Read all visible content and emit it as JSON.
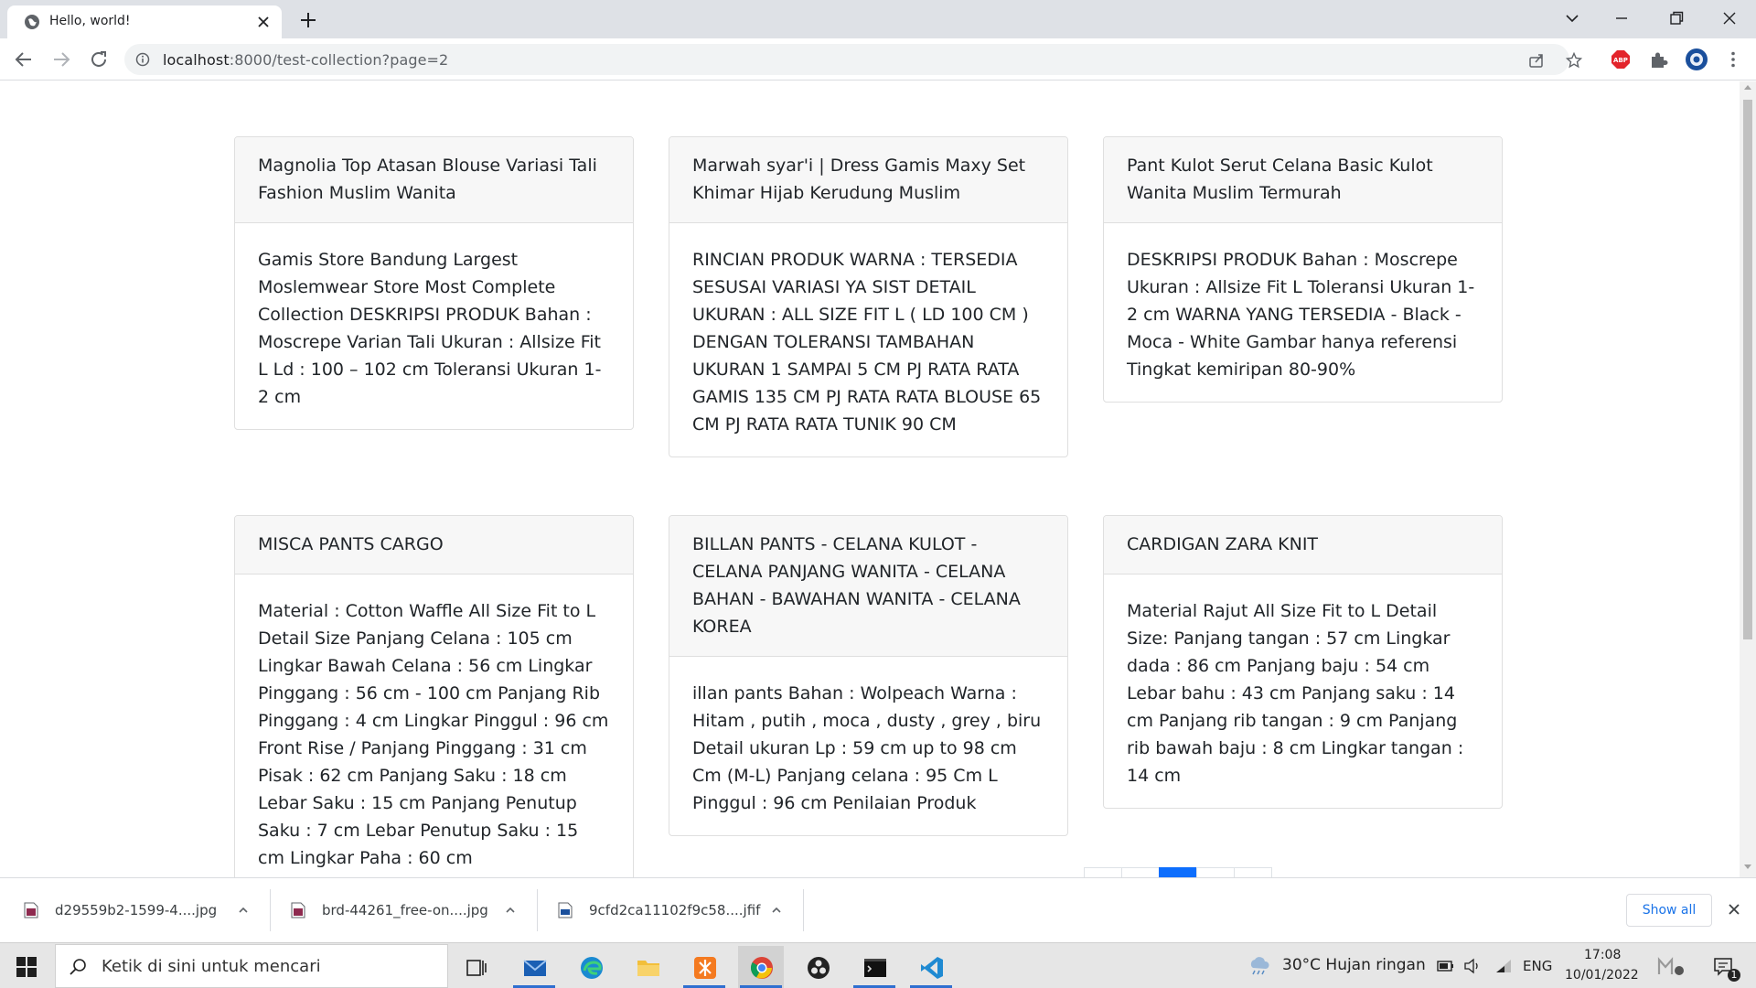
{
  "browser": {
    "tab": {
      "title": "Hello, world!"
    },
    "url": {
      "host": "localhost",
      "rest": ":8000/test-collection?page=2"
    }
  },
  "page": {
    "cards": [
      {
        "title": "Magnolia Top Atasan Blouse Variasi Tali Fashion Muslim Wanita",
        "body": "Gamis Store Bandung Largest Moslemwear Store Most Complete Collection DESKRIPSI PRODUK Bahan : Moscrepe Varian Tali Ukuran : Allsize Fit L Ld : 100 – 102 cm Toleransi Ukuran 1-2 cm"
      },
      {
        "title": "Marwah syar'i | Dress Gamis Maxy Set Khimar Hijab Kerudung Muslim",
        "body": "RINCIAN PRODUK WARNA : TERSEDIA SESUSAI VARIASI YA SIST DETAIL UKURAN : ALL SIZE FIT L ( LD 100 CM ) DENGAN TOLERANSI TAMBAHAN UKURAN 1 SAMPAI 5 CM PJ RATA RATA GAMIS 135 CM PJ RATA RATA BLOUSE 65 CM PJ RATA RATA TUNIK 90 CM"
      },
      {
        "title": "Pant Kulot Serut Celana Basic Kulot Wanita Muslim Termurah",
        "body": "DESKRIPSI PRODUK Bahan : Moscrepe Ukuran : Allsize Fit L Toleransi Ukuran 1-2 cm WARNA YANG TERSEDIA - Black - Moca - White Gambar hanya referensi Tingkat kemiripan 80-90%"
      },
      {
        "title": "MISCA PANTS CARGO",
        "body": "Material : Cotton Waffle All Size Fit to L Detail Size Panjang Celana : 105 cm Lingkar Bawah Celana : 56 cm Lingkar Pinggang : 56 cm - 100 cm Panjang Rib Pinggang : 4 cm Lingkar Pinggul : 96 cm Front Rise / Panjang Pinggang : 31 cm Pisak : 62 cm Panjang Saku : 18 cm Lebar Saku : 15 cm Panjang Penutup Saku : 7 cm Lebar Penutup Saku : 15 cm Lingkar Paha : 60 cm"
      },
      {
        "title": "BILLAN PANTS - CELANA KULOT - CELANA PANJANG WANITA - CELANA BAHAN - BAWAHAN WANITA - CELANA KOREA",
        "body": "illan pants Bahan : Wolpeach Warna : Hitam , putih , moca , dusty , grey , biru Detail ukuran Lp : 59 cm up to 98 cm Cm (M-L) Panjang celana : 95 Cm L Pinggul : 96 cm Penilaian Produk"
      },
      {
        "title": "CARDIGAN ZARA KNIT",
        "body": "Material Rajut All Size Fit to L Detail Size: Panjang tangan : 57 cm Lingkar dada : 86 cm Panjang baju : 54 cm Lebar bahu : 43 cm Panjang saku : 14 cm Panjang rib tangan : 9 cm Panjang rib bawah baju : 8 cm Lingkar tangan : 14 cm"
      }
    ],
    "pagination": {
      "active_page": 2,
      "accent": "#0d6efd"
    }
  },
  "downloads": {
    "items": [
      {
        "name": "d29559b2-1599-4....jpg"
      },
      {
        "name": "brd-44261_free-on....jpg"
      },
      {
        "name": "9cfd2ca11102f9c58....jfif"
      }
    ],
    "show_all": "Show all"
  },
  "taskbar": {
    "search_placeholder": "Ketik di sini untuk mencari",
    "weather": "30°C  Hujan ringan",
    "lang": "ENG",
    "time": "17:08",
    "date": "10/01/2022",
    "notification_count": "1"
  },
  "icons": {
    "back": "arrow-left-icon",
    "forward": "arrow-right-icon",
    "reload": "reload-icon",
    "info": "info-icon",
    "share": "share-icon",
    "bookmark": "star-icon",
    "adblock": "abp-icon",
    "extensions": "puzzle-icon",
    "profile": "avatar-icon",
    "menu": "kebab-menu-icon"
  }
}
